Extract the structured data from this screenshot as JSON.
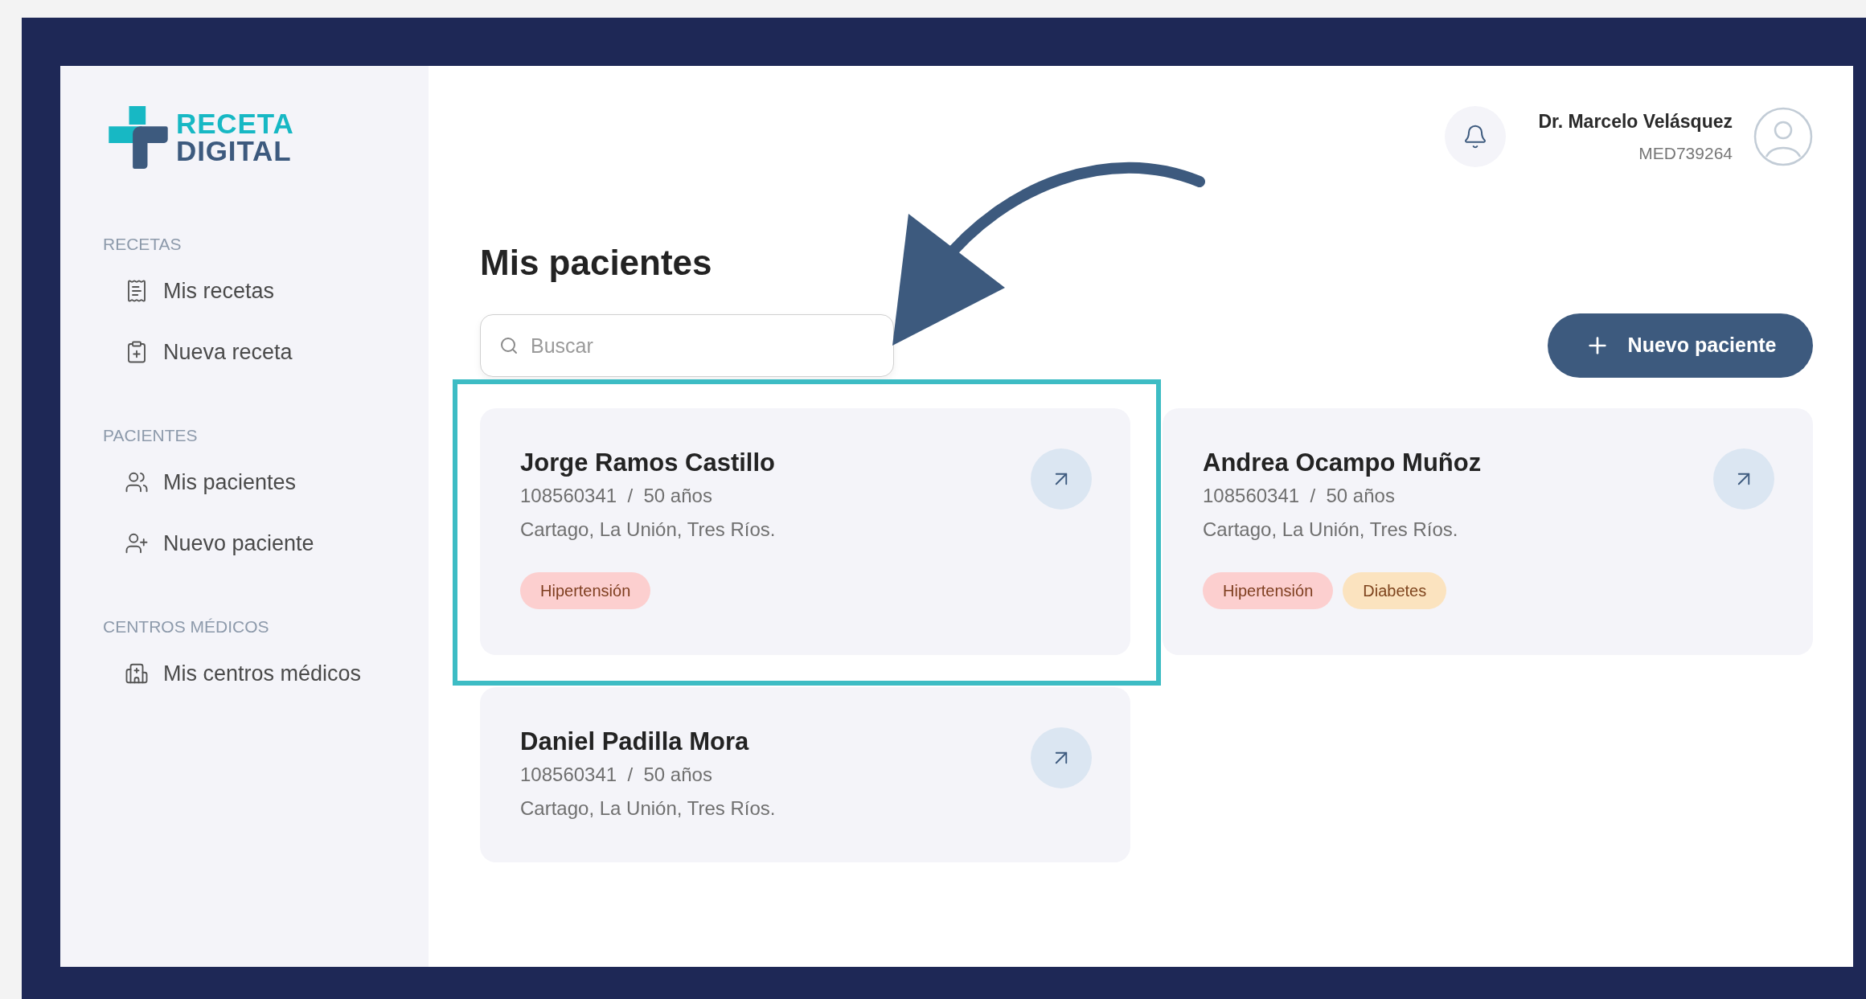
{
  "logo": {
    "line_1": "RECETA",
    "line_2": "DIGITAL"
  },
  "sidebar": {
    "sections": [
      {
        "label": "RECETAS",
        "items": [
          {
            "label": "Mis recetas"
          },
          {
            "label": "Nueva receta"
          }
        ]
      },
      {
        "label": "PACIENTES",
        "items": [
          {
            "label": "Mis pacientes"
          },
          {
            "label": "Nuevo paciente"
          }
        ]
      },
      {
        "label": "CENTROS MÉDICOS",
        "items": [
          {
            "label": "Mis centros médicos"
          }
        ]
      }
    ]
  },
  "header": {
    "user_name": "Dr. Marcelo Velásquez",
    "user_id": "MED739264"
  },
  "page": {
    "title": "Mis pacientes",
    "search": {
      "placeholder": "Buscar"
    },
    "new_button": "Nuevo paciente"
  },
  "patients": [
    {
      "name": "Jorge Ramos Castillo",
      "id": "108560341",
      "separator": "/",
      "age": "50 años",
      "address": "Cartago, La Unión, Tres Ríos.",
      "highlighted": true,
      "tags": [
        {
          "label": "Hipertensión",
          "color": "#fccfcf"
        }
      ]
    },
    {
      "name": "Andrea Ocampo Muñoz",
      "id": "108560341",
      "separator": "/",
      "age": "50 años",
      "address": "Cartago, La Unión, Tres Ríos.",
      "highlighted": false,
      "tags": [
        {
          "label": "Hipertensión",
          "color": "#fccfcf"
        },
        {
          "label": "Diabetes",
          "color": "#fbe3bf"
        }
      ]
    },
    {
      "name": "Daniel Padilla Mora",
      "id": "108560341",
      "separator": "/",
      "age": "50 años",
      "address": "Cartago, La Unión, Tres Ríos.",
      "highlighted": false
    }
  ]
}
